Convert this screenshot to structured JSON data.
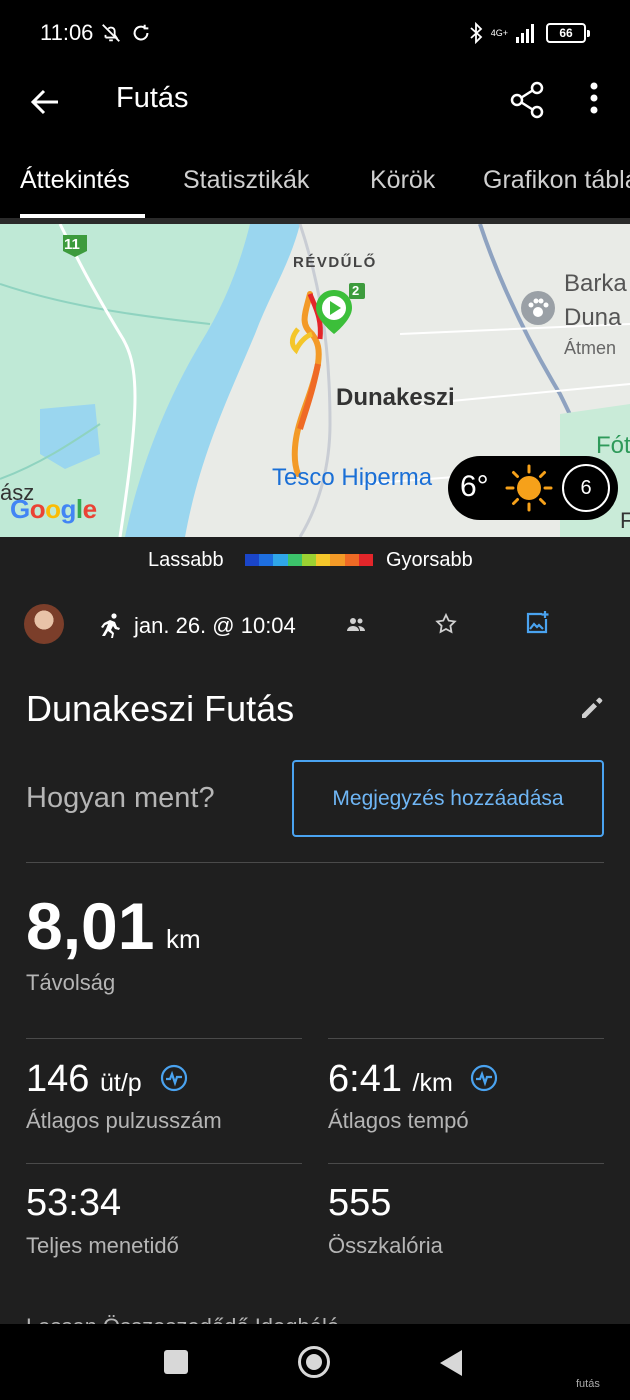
{
  "status_bar": {
    "time": "11:06",
    "network": "4G+",
    "battery": "66",
    "icons": [
      "bell-off-icon",
      "sync-icon",
      "bluetooth-icon",
      "signal-icon",
      "battery-icon"
    ]
  },
  "app_bar": {
    "title": "Futás",
    "icons": [
      "back-arrow-icon",
      "share-icon",
      "more-vert-icon"
    ]
  },
  "tabs": [
    {
      "label": "Áttekintés",
      "active": true
    },
    {
      "label": "Statisztikák",
      "active": false
    },
    {
      "label": "Körök",
      "active": false
    },
    {
      "label": "Grafikon táblázat",
      "active": false
    }
  ],
  "map": {
    "labels": {
      "revdulo": "RÉVDŰLŐ",
      "dunakeszi": "Dunakeszi",
      "tesco": "Tesco Hiperma",
      "barka1": "Barka",
      "barka2": "Duna",
      "atmeno": "Átmen",
      "fot": "Fót",
      "asz": "ász",
      "road11": "11",
      "road2": "2",
      "edge_r": "F"
    },
    "weather": {
      "temp": "6°",
      "wind": "6"
    },
    "google": [
      "G",
      "o",
      "o",
      "g",
      "l",
      "e"
    ]
  },
  "legend": {
    "slower": "Lassabb",
    "faster": "Gyorsabb",
    "colors": [
      "#1a45c9",
      "#1e6fe0",
      "#2fa6e8",
      "#3cc36b",
      "#9bd132",
      "#f4c62a",
      "#f39a27",
      "#ef6a25",
      "#e3262a"
    ]
  },
  "meta": {
    "date": "jan. 26. @ 10:04",
    "icons": [
      "avatar",
      "run-icon",
      "people-icon",
      "star-icon",
      "image-add-icon"
    ]
  },
  "activity": {
    "title": "Dunakeszi Futás",
    "question": "Hogyan ment?",
    "note_button": "Megjegyzés hozzáadása"
  },
  "distance": {
    "value": "8,01",
    "unit": "km",
    "label": "Távolság"
  },
  "stats": [
    {
      "value": "146",
      "unit": "üt/p",
      "label": "Átlagos pulzusszám",
      "icon": "heart-rate-icon"
    },
    {
      "value": "6:41",
      "unit": "/km",
      "label": "Átlagos tempó",
      "icon": "heart-rate-icon"
    },
    {
      "value": "53:34",
      "unit": "",
      "label": "Teljes menetidő",
      "icon": ""
    },
    {
      "value": "555",
      "unit": "",
      "label": "Összkalória",
      "icon": ""
    }
  ],
  "cutoff_text": "Lassan Összeszedődő Idegháló",
  "watermark": "futás"
}
